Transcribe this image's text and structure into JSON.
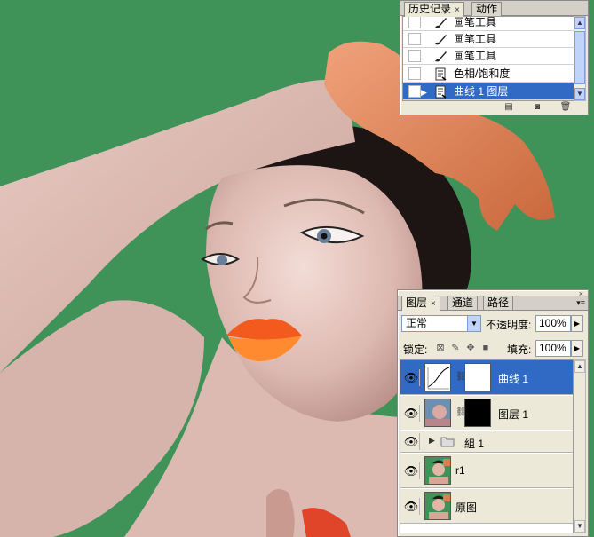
{
  "history_panel": {
    "tabs": [
      "历史记录",
      "动作"
    ],
    "items": [
      {
        "label": "画笔工具",
        "icon": "brush-icon",
        "selected": false
      },
      {
        "label": "画笔工具",
        "icon": "brush-icon",
        "selected": false
      },
      {
        "label": "画笔工具",
        "icon": "brush-icon",
        "selected": false
      },
      {
        "label": "色相/饱和度",
        "icon": "adjustment-doc-icon",
        "selected": false
      },
      {
        "label": "曲线 1 图层",
        "icon": "adjustment-doc-icon",
        "selected": true
      }
    ]
  },
  "layers_panel": {
    "tabs": [
      "图层",
      "通道",
      "路径"
    ],
    "blend_mode": "正常",
    "opacity_label": "不透明度:",
    "opacity_value": "100%",
    "lock_label": "锁定:",
    "fill_label": "填充:",
    "fill_value": "100%",
    "layers": [
      {
        "name": "曲线 1",
        "kind": "curves-adjustment",
        "mask": "white",
        "selected": true
      },
      {
        "name": "图层 1",
        "kind": "photo",
        "mask": "black",
        "selected": false
      },
      {
        "name": "組 1",
        "kind": "group",
        "selected": false
      },
      {
        "name": "r1",
        "kind": "photo",
        "selected": false
      },
      {
        "name": "原图",
        "kind": "photo",
        "selected": false
      }
    ]
  },
  "colors": {
    "canvas_background": "#3f9358",
    "selection": "#316ac5",
    "panel": "#ece9d8"
  }
}
